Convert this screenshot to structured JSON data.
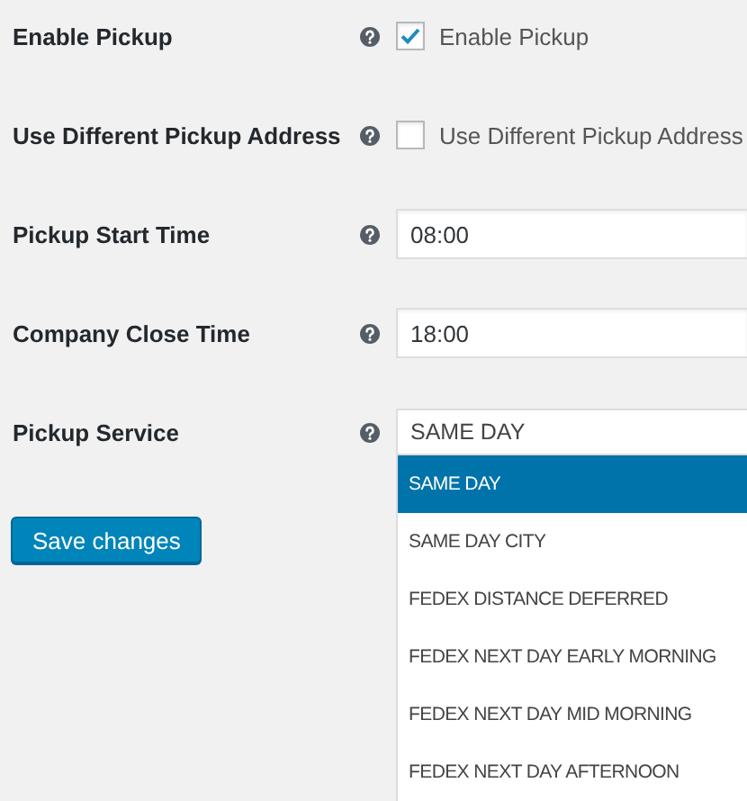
{
  "fields": [
    {
      "kind": "checkbox",
      "label": "Enable Pickup",
      "checkbox_label": "Enable Pickup",
      "checked": true
    },
    {
      "kind": "checkbox",
      "label": "Use Different Pickup Address",
      "checkbox_label": "Use Different Pickup Address",
      "checked": false
    },
    {
      "kind": "text",
      "label": "Pickup Start Time",
      "value": "08:00"
    },
    {
      "kind": "text",
      "label": "Company Close Time",
      "value": "18:00"
    },
    {
      "kind": "select",
      "label": "Pickup Service",
      "value": "SAME DAY",
      "expanded": true,
      "options": [
        {
          "label": "SAME DAY",
          "selected": true
        },
        {
          "label": "SAME DAY CITY",
          "selected": false
        },
        {
          "label": "FEDEX DISTANCE DEFERRED",
          "selected": false
        },
        {
          "label": "FEDEX NEXT DAY EARLY MORNING",
          "selected": false
        },
        {
          "label": "FEDEX NEXT DAY MID MORNING",
          "selected": false
        },
        {
          "label": "FEDEX NEXT DAY AFTERNOON",
          "selected": false
        }
      ]
    }
  ],
  "save_button": "Save changes"
}
